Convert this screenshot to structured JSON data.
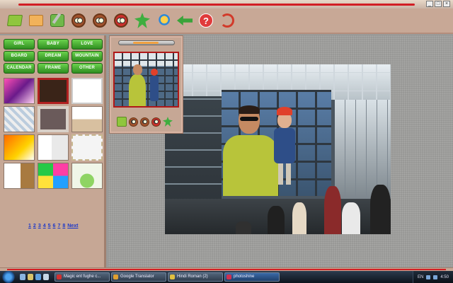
{
  "categories": [
    {
      "label": "GIRL"
    },
    {
      "label": "BABY"
    },
    {
      "label": "LOVE"
    },
    {
      "label": "BOARD"
    },
    {
      "label": "DREAM"
    },
    {
      "label": "MOUNTAIN"
    },
    {
      "label": "CALENDAR"
    },
    {
      "label": "FRAME"
    },
    {
      "label": "OTHER"
    }
  ],
  "pager": {
    "pages": [
      "1",
      "2",
      "3",
      "4",
      "5",
      "6",
      "7",
      "8"
    ],
    "next_label": "Next"
  },
  "toolbar": {
    "icons": [
      "new-folder-icon",
      "open-image-icon",
      "edit-image-icon",
      "owl-icon",
      "owl-icon",
      "owl-red-icon",
      "star-gear-icon",
      "tools-icon",
      "undo-arrow-icon",
      "help-icon",
      "exit-icon"
    ],
    "help_glyph": "?"
  },
  "window_controls": {
    "minimize": "_",
    "maximize": "□",
    "close": "×"
  },
  "taskbar": {
    "tasks": [
      {
        "label": "Magic ent fughe c...",
        "color": "#d23030"
      },
      {
        "label": "Google Translator",
        "color": "#e0a030"
      },
      {
        "label": "Hindi Roman (2)",
        "color": "#e0c040"
      },
      {
        "label": "photoshine",
        "color": "#d03050",
        "active": true
      }
    ],
    "tray_lang": "EN",
    "clock": "4:50"
  },
  "colors": {
    "panel": "#c6a795",
    "accent_red": "#d21e24",
    "category_green": "#2f8e20",
    "pager_blue": "#1c37c9"
  }
}
